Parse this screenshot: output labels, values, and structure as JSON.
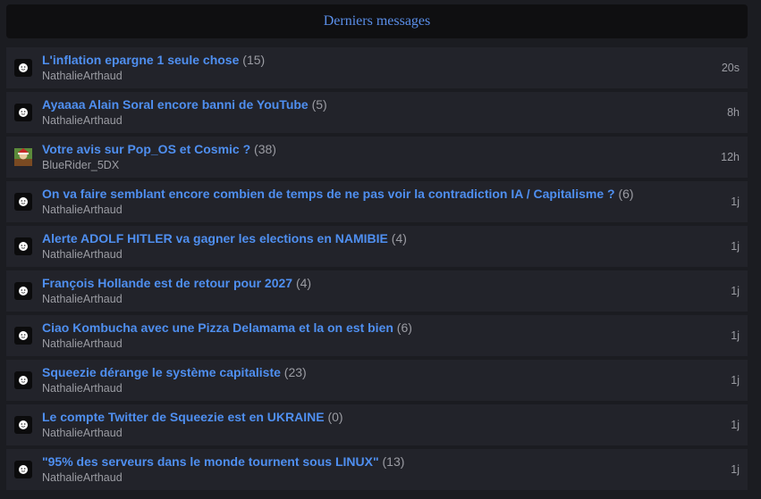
{
  "header": {
    "title": "Derniers messages"
  },
  "colors": {
    "accent": "#4f8ff0",
    "muted": "#9b9ca3",
    "row_bg": "#22232a",
    "page_bg": "#1b1c21"
  },
  "threads": [
    {
      "title": "L'inflation epargne 1 seule chose",
      "count": "(15)",
      "author": "NathalieArthaud",
      "time": "20s",
      "avatar": "smiley-avatar-icon"
    },
    {
      "title": "Ayaaaa Alain Soral encore banni de YouTube",
      "count": "(5)",
      "author": "NathalieArthaud",
      "time": "8h",
      "avatar": "smiley-avatar-icon"
    },
    {
      "title": "Votre avis sur Pop_OS et Cosmic ?",
      "count": "(38)",
      "author": "BlueRider_5DX",
      "time": "12h",
      "avatar": "user-picture-avatar-icon"
    },
    {
      "title": "On va faire semblant encore combien de temps de ne pas voir la contradiction IA / Capitalisme ?",
      "count": "(6)",
      "author": "NathalieArthaud",
      "time": "1j",
      "avatar": "smiley-avatar-icon"
    },
    {
      "title": "Alerte ADOLF HITLER va gagner les elections en NAMIBIE",
      "count": "(4)",
      "author": "NathalieArthaud",
      "time": "1j",
      "avatar": "smiley-avatar-icon"
    },
    {
      "title": "François Hollande est de retour pour 2027",
      "count": "(4)",
      "author": "NathalieArthaud",
      "time": "1j",
      "avatar": "smiley-avatar-icon"
    },
    {
      "title": "Ciao Kombucha avec une Pizza Delamama et la on est bien",
      "count": "(6)",
      "author": "NathalieArthaud",
      "time": "1j",
      "avatar": "smiley-avatar-icon"
    },
    {
      "title": "Squeezie dérange le système capitaliste",
      "count": "(23)",
      "author": "NathalieArthaud",
      "time": "1j",
      "avatar": "smiley-avatar-icon"
    },
    {
      "title": "Le compte Twitter de Squeezie est en UKRAINE",
      "count": "(0)",
      "author": "NathalieArthaud",
      "time": "1j",
      "avatar": "smiley-avatar-icon"
    },
    {
      "title": "\"95% des serveurs dans le monde tournent sous LINUX\"",
      "count": "(13)",
      "author": "NathalieArthaud",
      "time": "1j",
      "avatar": "smiley-avatar-icon"
    }
  ]
}
